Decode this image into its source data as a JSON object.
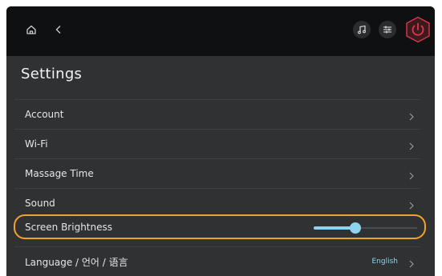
{
  "topbar": {
    "home_icon": "home-icon",
    "back_icon": "back-chevron-icon",
    "music_icon": "music-note-icon",
    "eq_icon": "equalizer-icon",
    "power_icon": "power-icon",
    "power_color": "#e0364a"
  },
  "page": {
    "title": "Settings"
  },
  "settings": {
    "account": "Account",
    "wifi": "Wi-Fi",
    "massage_time": "Massage Time",
    "sound": "Sound",
    "screen_brightness": "Screen Brightness",
    "language": "Language / 언어 / 语言",
    "language_value": "English"
  },
  "brightness": {
    "level_fraction": 0.4,
    "accent": "#8ed4f0",
    "highlight_color": "#f2a22a"
  }
}
